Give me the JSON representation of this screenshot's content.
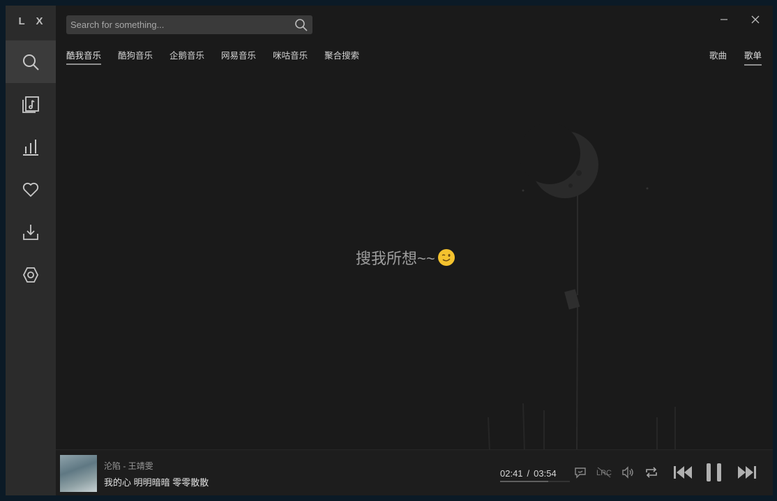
{
  "app": {
    "logo": "L X"
  },
  "sidebar": {
    "items": [
      {
        "icon": "search-icon",
        "active": true
      },
      {
        "icon": "music-library-icon"
      },
      {
        "icon": "leaderboard-icon"
      },
      {
        "icon": "heart-icon"
      },
      {
        "icon": "download-icon"
      },
      {
        "icon": "settings-icon"
      }
    ]
  },
  "search": {
    "placeholder": "Search for something...",
    "value": ""
  },
  "source_tabs": [
    "酷我音乐",
    "酷狗音乐",
    "企鹅音乐",
    "网易音乐",
    "咪咕音乐",
    "聚合搜索"
  ],
  "type_tabs": [
    "歌曲",
    "歌单"
  ],
  "main": {
    "empty_text": "搜我所想~~"
  },
  "player": {
    "title": "沦陷 - 王靖雯",
    "lyric": "我的心 明明暗暗 零零散散",
    "current_time": "02:41",
    "separator": "/",
    "total_time": "03:54",
    "progress": 0.69
  },
  "colors": {
    "sidebar_bg": "#2b2b2b",
    "main_bg": "#1a1a1a",
    "accent": "#8e8e8e"
  }
}
